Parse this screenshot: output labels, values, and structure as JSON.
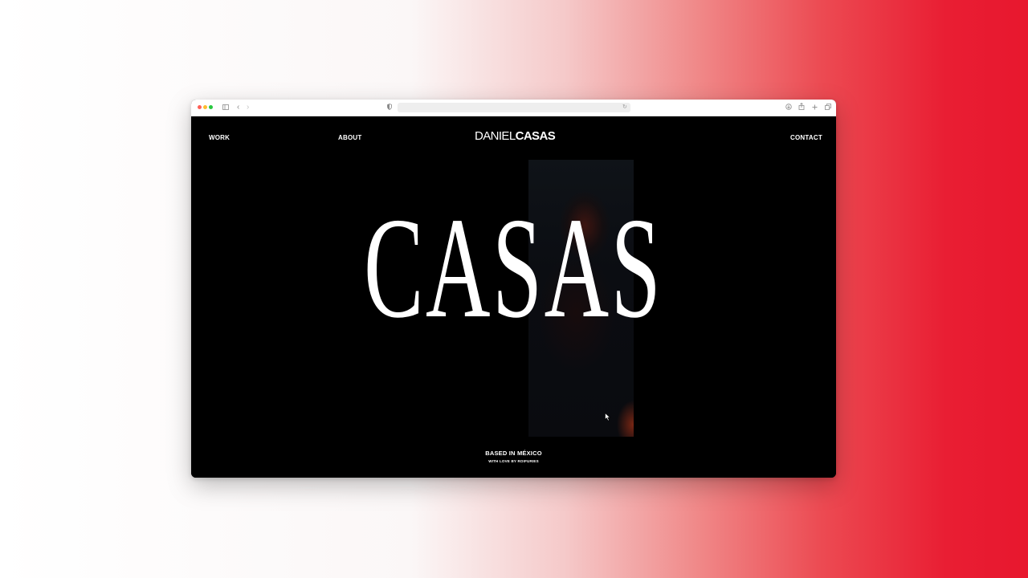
{
  "nav": {
    "work": "WORK",
    "about": "ABOUT",
    "contact": "CONTACT"
  },
  "logo": {
    "first": "DANIEL",
    "last": "CASAS"
  },
  "hero": {
    "title": "CASAS"
  },
  "footer": {
    "location": "BASED IN MÉXICO",
    "credit": "WITH LOVE BY ROIFURIES"
  },
  "browser": {
    "reload_glyph": "↻",
    "back_glyph": "‹",
    "forward_glyph": "›",
    "icons": [
      "sidebar-icon",
      "back-icon",
      "forward-icon",
      "shield-icon",
      "reload-icon",
      "download-icon",
      "share-icon",
      "new-tab-icon",
      "tabs-icon"
    ]
  },
  "colors": {
    "page_background": "#000000",
    "text": "#ffffff",
    "gradient_accent": "#e8172e"
  }
}
